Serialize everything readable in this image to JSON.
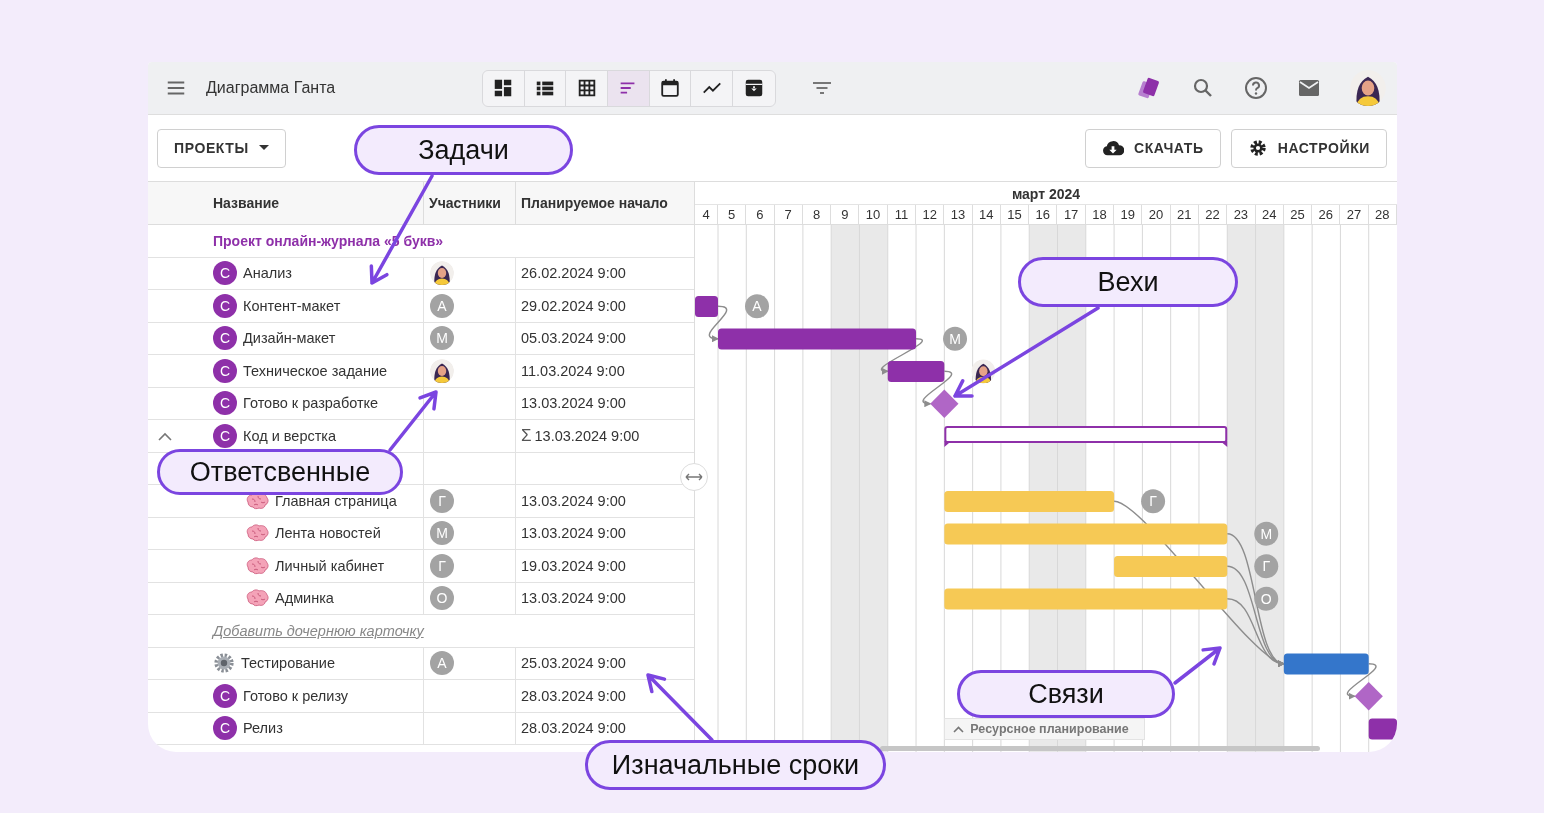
{
  "header": {
    "title": "Диаграмма Ганта",
    "views": [
      {
        "kind": "dashboard",
        "selected": false
      },
      {
        "kind": "list",
        "selected": false
      },
      {
        "kind": "table",
        "selected": false
      },
      {
        "kind": "gantt",
        "selected": true
      },
      {
        "kind": "calendar",
        "selected": false
      },
      {
        "kind": "chart",
        "selected": false
      },
      {
        "kind": "archive",
        "selected": false
      }
    ]
  },
  "actions": {
    "projects": "ПРОЕКТЫ",
    "download": "СКАЧАТЬ",
    "settings": "НАСТРОЙКИ"
  },
  "table": {
    "columns": [
      "Название",
      "Участники",
      "Планируемое начало"
    ],
    "project": "Проект онлайн-журнала «5 букв»",
    "rows": [
      {
        "kind": "task",
        "icon": {
          "kind": "letter",
          "text": "С"
        },
        "name": "Анализ",
        "assignee": {
          "kind": "photo"
        },
        "start": "26.02.2024 9:00"
      },
      {
        "kind": "task",
        "icon": {
          "kind": "letter",
          "text": "С"
        },
        "name": "Контент-макет",
        "assignee": {
          "kind": "letter",
          "text": "А"
        },
        "start": "29.02.2024 9:00",
        "bar": {
          "kind": "bar",
          "color": "#8e30a9"
        },
        "gantt_assignee": {
          "kind": "letter",
          "text": "А"
        }
      },
      {
        "kind": "task",
        "icon": {
          "kind": "letter",
          "text": "С"
        },
        "name": "Дизайн-макет",
        "assignee": {
          "kind": "letter",
          "text": "М"
        },
        "start": "05.03.2024 9:00",
        "bar": {
          "kind": "bar",
          "color": "#8e30a9",
          "incoming_link": true
        },
        "gantt_assignee": {
          "kind": "letter",
          "text": "М"
        }
      },
      {
        "kind": "task",
        "icon": {
          "kind": "letter",
          "text": "С"
        },
        "name": "Техническое задание",
        "assignee": {
          "kind": "photo"
        },
        "start": "11.03.2024 9:00",
        "bar": {
          "kind": "bar",
          "color": "#8e30a9",
          "incoming_link": true
        },
        "gantt_assignee": {
          "kind": "photo"
        }
      },
      {
        "kind": "task",
        "icon": {
          "kind": "letter",
          "text": "С"
        },
        "name": "Готово к разработке",
        "start": "13.03.2024 9:00",
        "bar": {
          "kind": "milestone",
          "color": "#b066c6",
          "incoming_link": true
        }
      },
      {
        "kind": "group",
        "icon": {
          "kind": "letter",
          "text": "С"
        },
        "name": "Код и верстка",
        "start_mark": "Σ",
        "start": "13.03.2024 9:00",
        "expanded": true,
        "bar": {
          "kind": "summary",
          "color": "#8e30a9"
        },
        "children": [
          {
            "kind": "task",
            "icon": {
              "kind": "brain"
            },
            "name": "Главная страница",
            "assignee": {
              "kind": "letter",
              "text": "Г"
            },
            "start": "13.03.2024 9:00",
            "bar": {
              "kind": "bar",
              "color": "#f6c955"
            },
            "gantt_assignee": {
              "kind": "letter",
              "text": "Г"
            }
          },
          {
            "kind": "task",
            "icon": {
              "kind": "brain"
            },
            "name": "Лента новостей",
            "assignee": {
              "kind": "letter",
              "text": "М"
            },
            "start": "13.03.2024 9:00",
            "bar": {
              "kind": "bar",
              "color": "#f6c955"
            },
            "gantt_assignee": {
              "kind": "letter",
              "text": "М"
            }
          },
          {
            "kind": "task",
            "icon": {
              "kind": "brain"
            },
            "name": "Личный кабинет",
            "assignee": {
              "kind": "letter",
              "text": "Г"
            },
            "start": "19.03.2024 9:00",
            "bar": {
              "kind": "bar",
              "color": "#f6c955"
            },
            "gantt_assignee": {
              "kind": "letter",
              "text": "Г"
            }
          },
          {
            "kind": "task",
            "icon": {
              "kind": "brain"
            },
            "name": "Админка",
            "assignee": {
              "kind": "letter",
              "text": "О"
            },
            "start": "13.03.2024 9:00",
            "bar": {
              "kind": "bar",
              "color": "#f6c955"
            },
            "gantt_assignee": {
              "kind": "letter",
              "text": "О"
            }
          },
          {
            "kind": "add_link",
            "text": "Добавить дочернюю карточку"
          }
        ]
      },
      {
        "kind": "task",
        "icon": {
          "kind": "gear"
        },
        "name": "Тестирование",
        "assignee": {
          "kind": "letter",
          "text": "А"
        },
        "start": "25.03.2024 9:00",
        "bar": {
          "kind": "bar",
          "color": "#3476cb",
          "incoming_link": true
        }
      },
      {
        "kind": "task",
        "icon": {
          "kind": "letter",
          "text": "С"
        },
        "name": "Готово к релизу",
        "start": "28.03.2024 9:00",
        "bar": {
          "kind": "milestone",
          "color": "#b066c6",
          "incoming_link": true
        }
      },
      {
        "kind": "task",
        "icon": {
          "kind": "letter",
          "text": "С"
        },
        "name": "Релиз",
        "start": "28.03.2024 9:00",
        "bar": {
          "kind": "bar",
          "color": "#8e30a9"
        }
      }
    ]
  },
  "gantt": {
    "month": "март 2024",
    "days": [
      {
        "label": "4",
        "weekend": false
      },
      {
        "label": "5",
        "weekend": false
      },
      {
        "label": "6",
        "weekend": false
      },
      {
        "label": "7",
        "weekend": false
      },
      {
        "label": "8",
        "weekend": false
      },
      {
        "label": "9",
        "weekend": true
      },
      {
        "label": "10",
        "weekend": true
      },
      {
        "label": "11",
        "weekend": false
      },
      {
        "label": "12",
        "weekend": false
      },
      {
        "label": "13",
        "weekend": false
      },
      {
        "label": "14",
        "weekend": false
      },
      {
        "label": "15",
        "weekend": false
      },
      {
        "label": "16",
        "weekend": true
      },
      {
        "label": "17",
        "weekend": true
      },
      {
        "label": "18",
        "weekend": false
      },
      {
        "label": "19",
        "weekend": false
      },
      {
        "label": "20",
        "weekend": false
      },
      {
        "label": "21",
        "weekend": false
      },
      {
        "label": "22",
        "weekend": false
      },
      {
        "label": "23",
        "weekend": true
      },
      {
        "label": "24",
        "weekend": true
      },
      {
        "label": "25",
        "weekend": false
      },
      {
        "label": "26",
        "weekend": false
      },
      {
        "label": "27",
        "weekend": false
      },
      {
        "label": "28",
        "weekend": false
      }
    ],
    "resource_tab": "Ресурсное планирование"
  },
  "callouts": [
    "Задачи",
    "Ответсвенные",
    "Вехи",
    "Связи",
    "Изначальные сроки"
  ]
}
